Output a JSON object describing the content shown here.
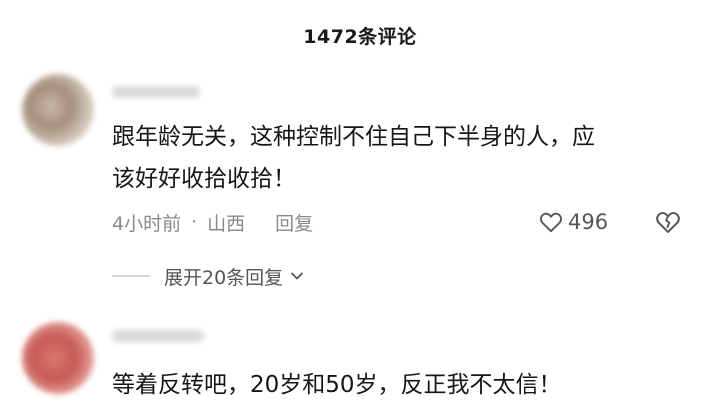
{
  "header": {
    "title": "1472条评论"
  },
  "comments": [
    {
      "text_line1": "跟年龄无关，这种控制不住自己下半身的人，应",
      "text_line2": "该好好收拾收拾！",
      "time": "4小时前",
      "separator": "·",
      "location": "山西",
      "reply_label": "回复",
      "likes": "496",
      "expand_label": "展开20条回复"
    },
    {
      "text_line1": "等着反转吧，20岁和50岁，反正我不太信！"
    }
  ],
  "icons": {
    "like": "heart-outline-icon",
    "dislike": "broken-heart-icon",
    "expand": "chevron-down-icon"
  }
}
